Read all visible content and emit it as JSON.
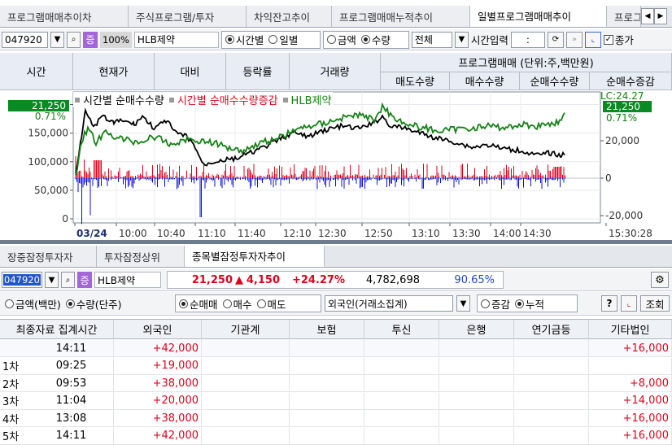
{
  "top_tabs": [
    "프로그램매매추이차",
    "주식프로그램/투자",
    "차익잔고추이",
    "프로그램매매누적추이",
    "일별프로그램매매추이",
    "프로그"
  ],
  "top_toolbar": {
    "code": "047920",
    "stock_badge": "증",
    "pct": "100%",
    "name": "HLB제약",
    "radio_time": "시간별",
    "radio_day": "일별",
    "radio_amount": "금액",
    "radio_qty": "수량",
    "scope": "전체",
    "time_input_label": "시간입력",
    "time_value": ":",
    "check_label": "종가"
  },
  "upper_header": {
    "time": "시간",
    "price": "현재가",
    "diff": "대비",
    "rate": "등락률",
    "volume": "거래량",
    "program": "프로그램매매 (단위:주,백만원)",
    "sub": [
      "매도수량",
      "매수수량",
      "순매수수량",
      "순매수증감"
    ]
  },
  "chart_data": {
    "type": "line",
    "legend": [
      "시간별 순매수수량",
      "시간별 순매수수량증감",
      "HLB제약"
    ],
    "colors": {
      "net_buy": "#000000",
      "net_buy_change": "#e0001b",
      "price": "#148214",
      "foreign_neg": "#0000e0"
    },
    "left_axis_ticks": [
      "200,000",
      "150,000",
      "100,000",
      "50,000",
      "0"
    ],
    "right_axis_ticks": [
      "20,000",
      "0",
      "-20,000"
    ],
    "x_ticks": [
      "03/24",
      "10:00",
      "10:40",
      "11:10",
      "11:40",
      "12:10",
      "12:30",
      "12:50",
      "13:10",
      "13:30",
      "14:00",
      "14:30",
      "15:30:28"
    ],
    "left_badge_price": "21,250",
    "left_badge_rate": "0.71%",
    "right_badge_price": "21,250",
    "right_badge_rate": "0.71%",
    "right_top_label": "LC:24.27"
  },
  "lower_tabs": [
    "장중잠정투자자",
    "투자잠정상위",
    "종목별잠정투자자추이"
  ],
  "lower_toolbar": {
    "code": "047920",
    "stock_badge": "증",
    "name": "HLB제약",
    "price": "21,250",
    "arrow": "▲",
    "change": "4,150",
    "rate": "+24.27%",
    "volume": "4,782,698",
    "ratio": "90.65%"
  },
  "lower_options": {
    "amount": "금액(백만)",
    "qty": "수량(단주)",
    "net": "순매매",
    "buy": "매수",
    "sell": "매도",
    "investor": "외국인(거래소집계)",
    "change": "증감",
    "cumulative": "누적",
    "help": "?",
    "query": "조회"
  },
  "grid": {
    "columns": [
      "최종자료 집계시간",
      "외국인",
      "기관계",
      "보험",
      "투신",
      "은행",
      "연기금등",
      "기타법인"
    ],
    "rows": [
      {
        "label": "",
        "time": "14:11",
        "foreign": "+42,000",
        "other": "+16,000"
      },
      {
        "label": "1차",
        "time": "09:25",
        "foreign": "+19,000",
        "other": ""
      },
      {
        "label": "2차",
        "time": "09:53",
        "foreign": "+38,000",
        "other": "+8,000"
      },
      {
        "label": "3차",
        "time": "11:04",
        "foreign": "+20,000",
        "other": "+14,000"
      },
      {
        "label": "4차",
        "time": "13:08",
        "foreign": "+38,000",
        "other": "+16,000"
      },
      {
        "label": "5차",
        "time": "14:11",
        "foreign": "+42,000",
        "other": "+16,000"
      }
    ]
  }
}
